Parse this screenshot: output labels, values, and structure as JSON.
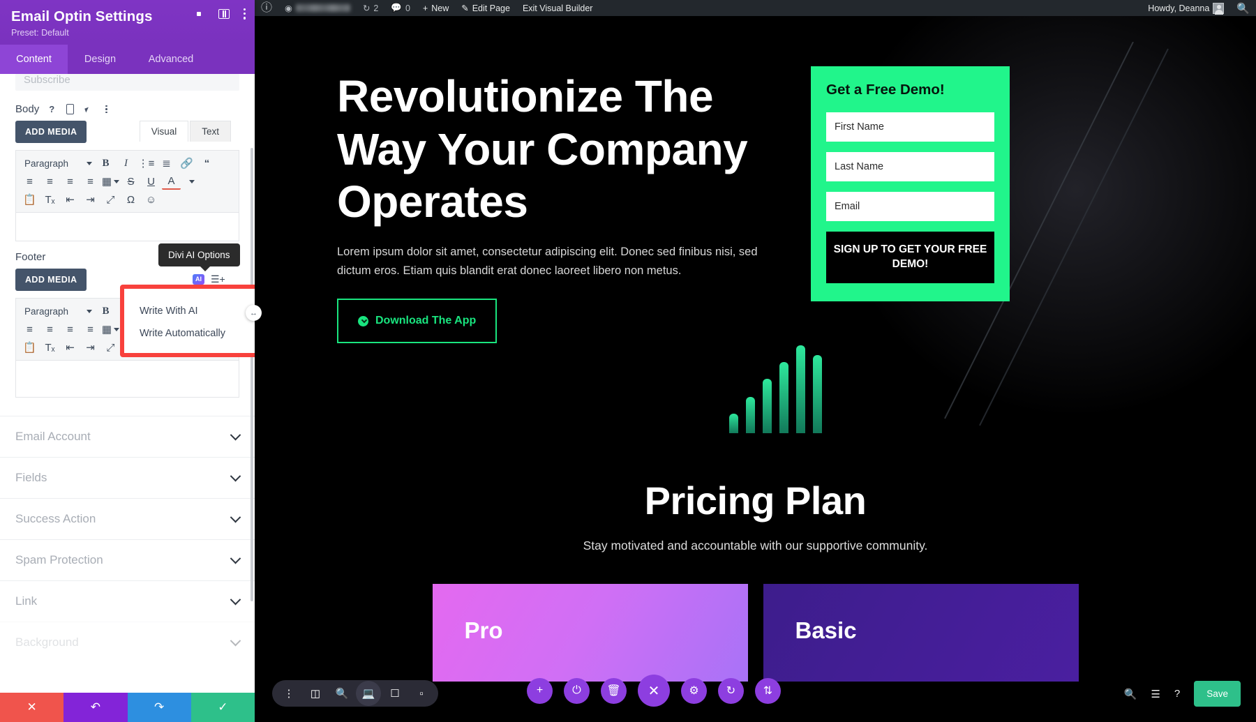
{
  "adminbar": {
    "wp_logo_icon": "wordpress-logo-icon",
    "site_name": "",
    "site_icon": "dashboard-icon",
    "updates": {
      "icon": "updates-icon",
      "count": "2"
    },
    "comments": {
      "icon": "comment-icon",
      "count": "0"
    },
    "new_label": "New",
    "new_icon": "plus-icon",
    "edit_page_label": "Edit Page",
    "edit_icon": "pencil-icon",
    "exit_label": "Exit Visual Builder",
    "howdy": "Howdy, Deanna",
    "search_icon": "search-icon"
  },
  "panel": {
    "title": "Email Optin Settings",
    "preset": "Preset: Default",
    "header_icons": [
      "focus-icon",
      "layout-icon",
      "more-options-icon"
    ],
    "tabs": [
      {
        "label": "Content",
        "active": true
      },
      {
        "label": "Design",
        "active": false
      },
      {
        "label": "Advanced",
        "active": false
      }
    ],
    "subscribe_ghost": "Subscribe",
    "body": {
      "label": "Body",
      "help_icon": "help-icon",
      "responsive_icon": "mobile-icon",
      "hover_icon": "cursor-icon",
      "more_icon": "more-dots-icon",
      "add_media": "ADD MEDIA",
      "editor_tabs": [
        {
          "label": "Visual",
          "active": true
        },
        {
          "label": "Text",
          "active": false
        }
      ]
    },
    "footer": {
      "label": "Footer",
      "add_media": "ADD MEDIA"
    },
    "toolbar": {
      "format_select": "Paragraph",
      "row1": [
        "bold-icon",
        "italic-icon",
        "bullet-list-icon",
        "numbered-list-icon",
        "link-icon",
        "blockquote-icon"
      ],
      "row1_labels": [
        "B",
        "I",
        "☰",
        "☰",
        "🔗",
        "“"
      ],
      "row2_labels": [
        "≡",
        "≡",
        "≡",
        "≡",
        "▦",
        "S",
        "U",
        "A"
      ],
      "row3_labels": [
        "📋",
        "Tₓ",
        "⇤",
        "⇥",
        "⛶",
        "Ω"
      ]
    },
    "tooltip": "Divi AI Options",
    "ai_badge": "AI",
    "ai_menu": [
      {
        "label": "Write With AI"
      },
      {
        "label": "Write Automatically"
      }
    ],
    "accordions": [
      {
        "label": "Email Account"
      },
      {
        "label": "Fields"
      },
      {
        "label": "Success Action"
      },
      {
        "label": "Spam Protection"
      },
      {
        "label": "Link"
      },
      {
        "label": "Background"
      }
    ],
    "footer_actions": [
      {
        "name": "discard",
        "icon": "close-icon",
        "color": "#f0544c"
      },
      {
        "name": "undo",
        "icon": "undo-icon",
        "color": "#8324d8"
      },
      {
        "name": "redo",
        "icon": "redo-icon",
        "color": "#2d8fe0"
      },
      {
        "name": "save",
        "icon": "check-icon",
        "color": "#2ec08a"
      }
    ],
    "drag_handle_icon": "resize-handle-icon"
  },
  "preview": {
    "hero": {
      "title": "Revolutionize The Way Your Company Operates",
      "subtitle": "Lorem ipsum dolor sit amet, consectetur adipiscing elit. Donec sed finibus nisi, sed dictum eros. Etiam quis blandit erat donec laoreet libero non metus.",
      "button": "Download The App",
      "button_icon": "download-icon"
    },
    "optin": {
      "heading": "Get a Free Demo!",
      "fields": [
        {
          "name": "first-name",
          "placeholder": "First Name",
          "value": ""
        },
        {
          "name": "last-name",
          "placeholder": "Last Name",
          "value": ""
        },
        {
          "name": "email",
          "placeholder": "Email",
          "value": ""
        }
      ],
      "submit": "SIGN UP TO GET YOUR FREE DEMO!",
      "bg_color": "#21f58b"
    },
    "pricing": {
      "title": "Pricing Plan",
      "subtitle": "Stay motivated and accountable with our supportive community.",
      "plans": [
        {
          "label": "Pro"
        },
        {
          "label": "Basic"
        }
      ]
    }
  },
  "divi_toolbar": {
    "left": [
      "more-dots-icon",
      "wireframe-icon",
      "zoom-out-icon",
      "desktop-icon",
      "tablet-icon",
      "phone-icon"
    ],
    "center": [
      "add-icon",
      "power-icon",
      "trash-icon",
      "close-icon",
      "settings-icon",
      "history-icon",
      "portability-icon"
    ],
    "right": [
      "search-icon",
      "layers-icon",
      "help-icon"
    ],
    "save_label": "Save"
  }
}
